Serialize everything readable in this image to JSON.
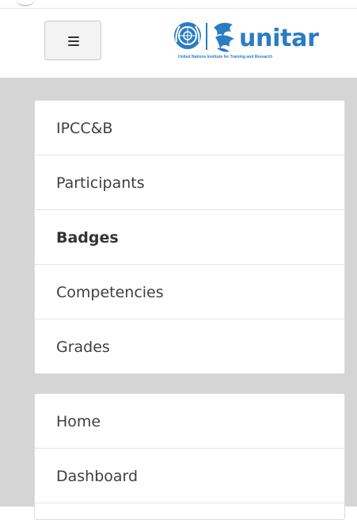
{
  "header": {
    "menu_toggle_icon": "hamburger-menu-icon",
    "logo": {
      "emblem_icon": "un-emblem-icon",
      "bird_icon": "unitar-bird-icon",
      "wordmark": "unitar",
      "tagline": "United Nations Institute for Training and Research",
      "brand_color": "#2a7cc4"
    }
  },
  "primary_nav": {
    "items": [
      {
        "label": "IPCC&B",
        "active": false
      },
      {
        "label": "Participants",
        "active": false
      },
      {
        "label": "Badges",
        "active": true
      },
      {
        "label": "Competencies",
        "active": false
      },
      {
        "label": "Grades",
        "active": false
      }
    ]
  },
  "secondary_nav": {
    "items": [
      {
        "label": "Home",
        "active": false
      },
      {
        "label": "Dashboard",
        "active": false
      }
    ]
  },
  "colors": {
    "background": "#d5d5d5",
    "panel": "#ffffff",
    "text": "#3f3f3f"
  }
}
